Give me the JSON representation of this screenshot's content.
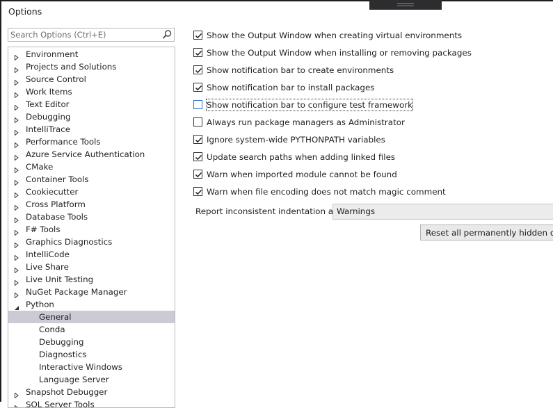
{
  "window": {
    "title": "Options"
  },
  "search": {
    "placeholder": "Search Options (Ctrl+E)",
    "value": ""
  },
  "tree": {
    "top_items": [
      {
        "label": "Environment"
      },
      {
        "label": "Projects and Solutions"
      },
      {
        "label": "Source Control"
      },
      {
        "label": "Work Items"
      },
      {
        "label": "Text Editor"
      },
      {
        "label": "Debugging"
      },
      {
        "label": "IntelliTrace"
      },
      {
        "label": "Performance Tools"
      },
      {
        "label": "Azure Service Authentication"
      },
      {
        "label": "CMake"
      },
      {
        "label": "Container Tools"
      },
      {
        "label": "Cookiecutter"
      },
      {
        "label": "Cross Platform"
      },
      {
        "label": "Database Tools"
      },
      {
        "label": "F# Tools"
      },
      {
        "label": "Graphics Diagnostics"
      },
      {
        "label": "IntelliCode"
      },
      {
        "label": "Live Share"
      },
      {
        "label": "Live Unit Testing"
      },
      {
        "label": "NuGet Package Manager"
      }
    ],
    "python": {
      "label": "Python",
      "expanded": true,
      "children": [
        {
          "label": "General",
          "selected": true
        },
        {
          "label": "Conda"
        },
        {
          "label": "Debugging"
        },
        {
          "label": "Diagnostics"
        },
        {
          "label": "Interactive Windows"
        },
        {
          "label": "Language Server"
        }
      ]
    },
    "after_items": [
      {
        "label": "Snapshot Debugger"
      },
      {
        "label": "SQL Server Tools"
      }
    ]
  },
  "options": [
    {
      "label": "Show the Output Window when creating virtual environments",
      "checked": true
    },
    {
      "label": "Show the Output Window when installing or removing packages",
      "checked": true
    },
    {
      "label": "Show notification bar to create environments",
      "checked": true
    },
    {
      "label": "Show notification bar to install packages",
      "checked": true
    },
    {
      "label": "Show notification bar to configure test framework",
      "checked": false
    },
    {
      "label": "Always run package managers as Administrator",
      "checked": false
    },
    {
      "label": "Ignore system-wide PYTHONPATH variables",
      "checked": true
    },
    {
      "label": "Update search paths when adding linked files",
      "checked": true
    },
    {
      "label": "Warn when imported module cannot be found",
      "checked": true
    },
    {
      "label": "Warn when file encoding does not match magic comment",
      "checked": true
    }
  ],
  "indentation": {
    "label": "Report inconsistent indentation as",
    "value": "Warnings"
  },
  "reset_button": {
    "label": "Reset all permanently hidden dialogs"
  },
  "colors": {
    "selected_row": "#cbcbd6",
    "focus_checkbox": "#2a6fd6"
  }
}
